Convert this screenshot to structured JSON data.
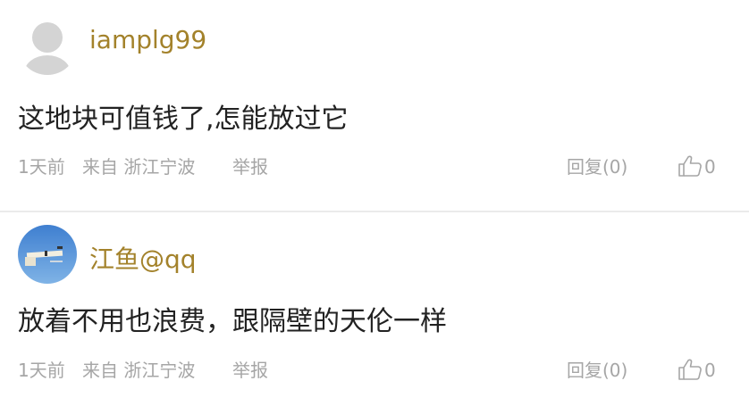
{
  "comments": [
    {
      "username": "iamplg99",
      "text": "这地块可值钱了,怎能放过它",
      "time": "1天前",
      "location": "来自 浙江宁波",
      "report_label": "举报",
      "reply_label": "回复(0)",
      "like_count": "0",
      "avatar": "default-avatar-icon"
    },
    {
      "username": "江鱼@qq",
      "text": "放着不用也浪费，跟隔壁的天伦一样",
      "time": "1天前",
      "location": "来自 浙江宁波",
      "report_label": "举报",
      "reply_label": "回复(0)",
      "like_count": "0",
      "avatar": "sky-photo-avatar"
    }
  ],
  "colors": {
    "username": "#a3822b",
    "meta": "#a6a6a6",
    "text": "#222222",
    "divider": "#ebebeb"
  }
}
